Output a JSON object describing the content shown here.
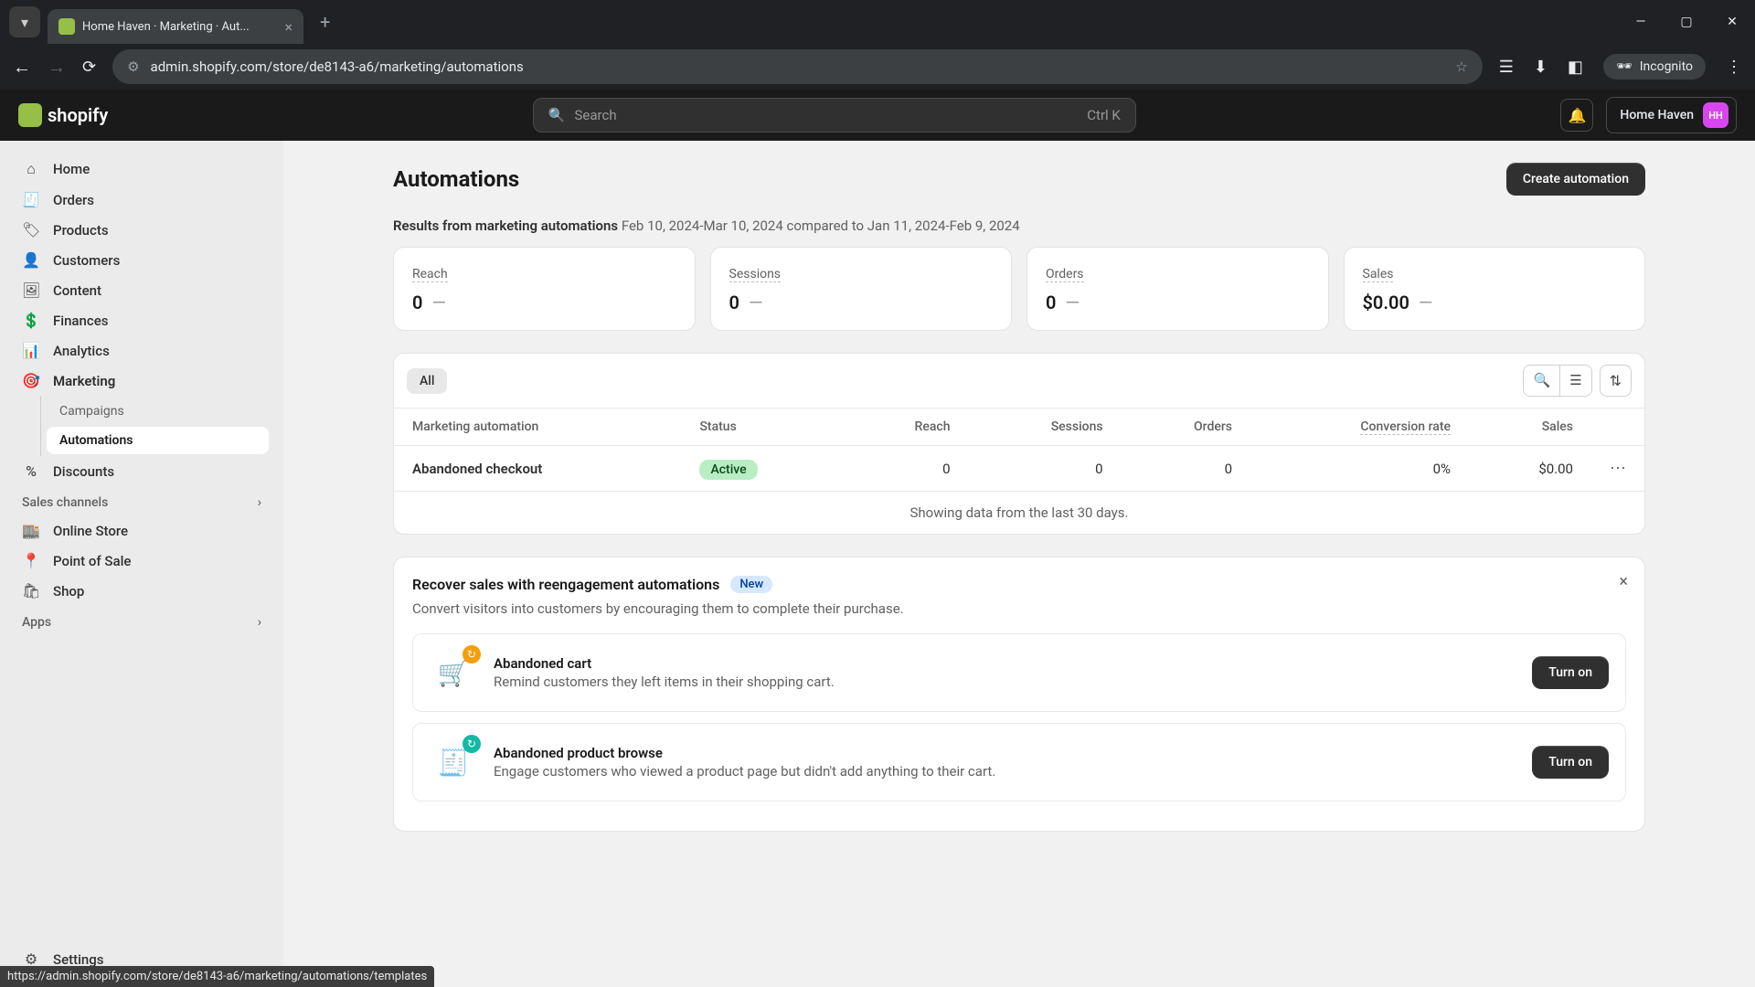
{
  "browser": {
    "tab_title": "Home Haven · Marketing · Aut...",
    "url": "admin.shopify.com/store/de8143-a6/marketing/automations",
    "incognito_label": "Incognito",
    "status_url": "https://admin.shopify.com/store/de8143-a6/marketing/automations/templates"
  },
  "header": {
    "logo_text": "shopify",
    "search_placeholder": "Search",
    "search_shortcut": "Ctrl K",
    "store_name": "Home Haven",
    "avatar_initials": "HH"
  },
  "sidebar": {
    "items": [
      {
        "label": "Home"
      },
      {
        "label": "Orders"
      },
      {
        "label": "Products"
      },
      {
        "label": "Customers"
      },
      {
        "label": "Content"
      },
      {
        "label": "Finances"
      },
      {
        "label": "Analytics"
      },
      {
        "label": "Marketing"
      },
      {
        "label": "Discounts"
      }
    ],
    "marketing_sub": [
      {
        "label": "Campaigns"
      },
      {
        "label": "Automations"
      }
    ],
    "sales_channels_label": "Sales channels",
    "sales_channels": [
      {
        "label": "Online Store"
      },
      {
        "label": "Point of Sale"
      },
      {
        "label": "Shop"
      }
    ],
    "apps_label": "Apps",
    "settings_label": "Settings"
  },
  "page": {
    "title": "Automations",
    "create_btn": "Create automation",
    "results_label": "Results from marketing automations",
    "results_dates": "Feb 10, 2024-Mar 10, 2024 compared to Jan 11, 2024-Feb 9, 2024"
  },
  "metrics": [
    {
      "label": "Reach",
      "value": "0",
      "delta": "—"
    },
    {
      "label": "Sessions",
      "value": "0",
      "delta": "—"
    },
    {
      "label": "Orders",
      "value": "0",
      "delta": "—"
    },
    {
      "label": "Sales",
      "value": "$0.00",
      "delta": "—"
    }
  ],
  "table": {
    "filter_all": "All",
    "columns": [
      "Marketing automation",
      "Status",
      "Reach",
      "Sessions",
      "Orders",
      "Conversion rate",
      "Sales"
    ],
    "rows": [
      {
        "name": "Abandoned checkout",
        "status": "Active",
        "reach": "0",
        "sessions": "0",
        "orders": "0",
        "conversion": "0%",
        "sales": "$0.00"
      }
    ],
    "footer": "Showing data from the last 30 days."
  },
  "promo": {
    "title": "Recover sales with reengagement automations",
    "badge": "New",
    "desc": "Convert visitors into customers by encouraging them to complete their purchase.",
    "turn_on": "Turn on",
    "items": [
      {
        "title": "Abandoned cart",
        "desc": "Remind customers they left items in their shopping cart."
      },
      {
        "title": "Abandoned product browse",
        "desc": "Engage customers who viewed a product page but didn't add anything to their cart."
      }
    ]
  }
}
